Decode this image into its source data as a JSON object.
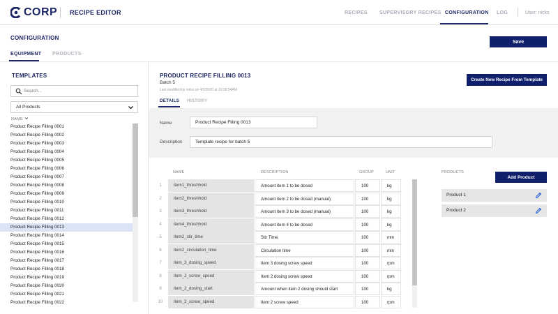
{
  "brand": {
    "logo_text": "CORP",
    "app_name": "RECIPE EDITOR",
    "accent": "#1d2766",
    "button_color": "#0f1f6b"
  },
  "nav": {
    "items": [
      "RECIPES",
      "SUPERVISORY RECIPES",
      "CONFIGURATION",
      "LOG"
    ],
    "active": "CONFIGURATION",
    "user": "User: nicks"
  },
  "config": {
    "title": "CONFIGURATION",
    "save_label": "Save",
    "tabs": [
      "EQUIPMENT",
      "PRODUCTS"
    ],
    "active_tab": "EQUIPMENT"
  },
  "templates": {
    "title": "TEMPLATES",
    "search_placeholder": "Search...",
    "filter_value": "All Products",
    "column_header": "NAME",
    "items": [
      "Product Recipe Filling 0001",
      "Product Recipe Filling 0002",
      "Product Recipe Filling 0003",
      "Product Recipe Filling 0004",
      "Product Recipe Filling 0005",
      "Product Recipe Filling 0006",
      "Product Recipe Filling 0007",
      "Product Recipe Filling 0008",
      "Product Recipe Filling 0009",
      "Product Recipe Filling 0010",
      "Product Recipe Filling 0011",
      "Product Recipe Filling 0012",
      "Product Recipe Filling 0013",
      "Product Recipe Filling 0014",
      "Product Recipe Filling 0015",
      "Product Recipe Filling 0016",
      "Product Recipe Filling 0017",
      "Product Recipe Filling 0018",
      "Product Recipe Filling 0019",
      "Product Recipe Filling 0020",
      "Product Recipe Filling 0021",
      "Product Recipe Filling 0022"
    ],
    "selected_index": 12
  },
  "detail": {
    "title": "PRODUCT RECIPE FILLING 0013",
    "batch": "Batch 5",
    "modified": "Last modified by nicks on 4/2/2020 at 10:30:54AM",
    "create_label": "Create New Recipe From Template",
    "tabs": [
      "DETAILS",
      "HISTORY"
    ],
    "active_tab": "DETAILS",
    "name_label": "Name",
    "name_value": "Product Recipe Filling 0013",
    "desc_label": "Description",
    "desc_value": "Template recipe for batch 5"
  },
  "table": {
    "headers": [
      "NAME",
      "DESCRIPTION",
      "GROUP",
      "UNIT"
    ],
    "rows": [
      {
        "n": "1",
        "name": "item1_threshhold",
        "desc": "Amount item 1 to be dosed",
        "group": "100",
        "unit": "kg"
      },
      {
        "n": "2",
        "name": "item2_threshhold",
        "desc": "Amount item 2 to be dosed (manual)",
        "group": "100",
        "unit": "kg"
      },
      {
        "n": "3",
        "name": "item3_threshhold",
        "desc": "Amount item 3 to be dosed (manual)",
        "group": "100",
        "unit": "kg"
      },
      {
        "n": "4",
        "name": "item4_threshhold",
        "desc": "Amount item 4 to be dosed",
        "group": "100",
        "unit": "kg"
      },
      {
        "n": "5",
        "name": "item2_stir_time",
        "desc": "Stir Time",
        "group": "100",
        "unit": "min"
      },
      {
        "n": "6",
        "name": "item2_circulation_time",
        "desc": "Circulation time",
        "group": "100",
        "unit": "min"
      },
      {
        "n": "7",
        "name": "item_3_dosing_speed",
        "desc": "Item 3 dosing screw speed",
        "group": "100",
        "unit": "rpm"
      },
      {
        "n": "8",
        "name": "item_2_screw_speed",
        "desc": "Item 2 dosing screw speed",
        "group": "100",
        "unit": "rpm"
      },
      {
        "n": "9",
        "name": "item_2_dosing_start",
        "desc": "Amount when item 2 dosing should start",
        "group": "100",
        "unit": "kg"
      },
      {
        "n": "10",
        "name": "item_2_screw_speed",
        "desc": "Item 2 screw speed",
        "group": "100",
        "unit": "rpm"
      }
    ]
  },
  "products": {
    "header": "PRODUCTS",
    "add_label": "Add Product",
    "items": [
      "Product 1",
      "Product 2"
    ]
  },
  "icons": {
    "logo": "corp-logo-icon",
    "search": "search-icon",
    "chevron": "chevron-down-icon",
    "pencil": "pencil-icon",
    "sort": "sort-chevron-icon"
  }
}
